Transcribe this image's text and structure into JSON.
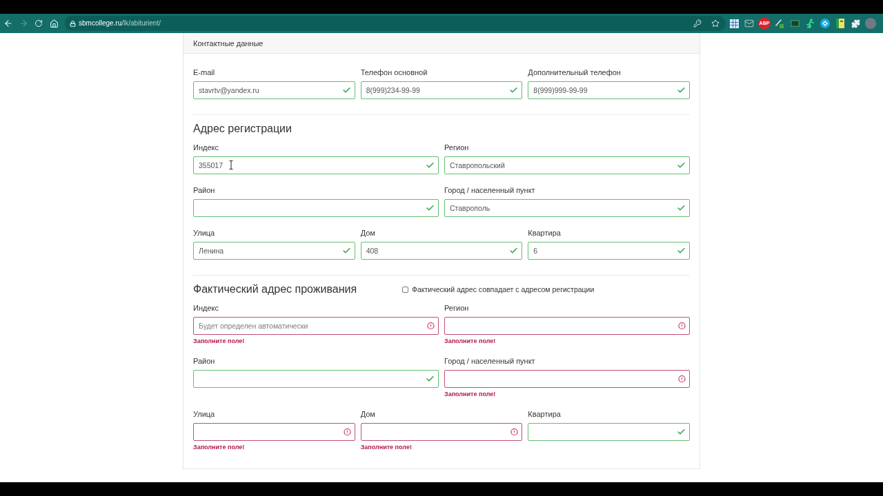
{
  "browser": {
    "forward": {
      "disabled": true
    },
    "url_host": "sbmcollege.ru",
    "url_path": "/lk/abiturient/",
    "abp_badge": "ABP"
  },
  "card": {
    "header": "Контактные данные",
    "sections": [
      {
        "rows": [
          [
            {
              "label": "E-mail",
              "value": "stavrtv@yandex.ru",
              "valid": true
            },
            {
              "label": "Телефон основной",
              "value": "8(999)234-99-99",
              "valid": true
            },
            {
              "label": "Дополнительный телефон",
              "value": "8(999)999-99-99",
              "valid": true
            }
          ]
        ]
      },
      {
        "title": "Адрес регистрации",
        "rows": [
          [
            {
              "label": "Индекс",
              "value": "355017",
              "valid": true
            },
            {
              "label": "Регион",
              "value": "Ставропольский",
              "valid": true
            }
          ],
          [
            {
              "label": "Район",
              "valid": true
            },
            {
              "label": "Город / населенный пункт",
              "value": "Ставрополь",
              "valid": true
            }
          ],
          [
            {
              "label": "Улица",
              "value": "Ленина",
              "valid": true
            },
            {
              "label": "Дом",
              "value": "408",
              "valid": true
            },
            {
              "label": "Квартира",
              "value": "6",
              "valid": true
            }
          ]
        ]
      },
      {
        "title": "Фактический адрес проживания",
        "same_address": {
          "label": "Фактический адрес совпадает с адресом регистрации",
          "checked": false
        },
        "rows": [
          [
            {
              "label": "Индекс",
              "placeholder": "Будет определен автоматически",
              "valid": false,
              "error": "Заполните поле!"
            },
            {
              "label": "Регион",
              "valid": false,
              "error": "Заполните поле!"
            }
          ],
          [
            {
              "label": "Район",
              "valid": true
            },
            {
              "label": "Город / населенный пункт",
              "valid": false,
              "error": "Заполните поле!"
            }
          ],
          [
            {
              "label": "Улица",
              "valid": false,
              "error": "Заполните поле!"
            },
            {
              "label": "Дом",
              "valid": false,
              "error": "Заполните поле!"
            },
            {
              "label": "Квартира",
              "valid": true
            }
          ]
        ]
      }
    ]
  }
}
